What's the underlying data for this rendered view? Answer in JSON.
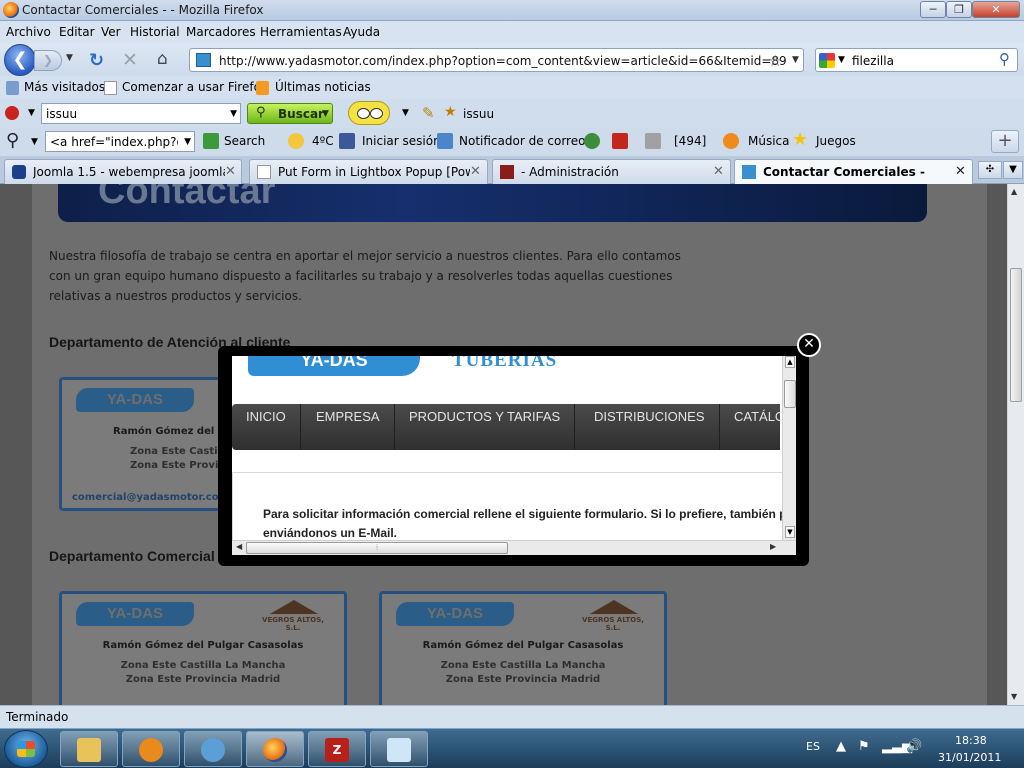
{
  "window": {
    "title": "Contactar Comerciales - - Mozilla Firefox",
    "min": "─",
    "max": "❐",
    "close": "✕"
  },
  "menu": [
    "Archivo",
    "Editar",
    "Ver",
    "Historial",
    "Marcadores",
    "Herramientas",
    "Ayuda"
  ],
  "nav": {
    "url": "http://www.yadasmotor.com/index.php?option=com_content&view=article&id=66&Itemid=89",
    "search_query": "filezilla"
  },
  "bookmarks": [
    "Más visitados",
    "Comenzar a usar Firefox",
    "Últimas noticias"
  ],
  "toolbar1": {
    "search_value": "issuu",
    "buscar_label": "Buscar",
    "issuu_label": "issuu"
  },
  "toolbar2": {
    "combo_value": "<a href=\"index.php?opt",
    "search_label": "Search",
    "weather": "4ºC",
    "facebook": "Iniciar sesión",
    "mail": "Notificador de correo",
    "count": "[494]",
    "music": "Música",
    "games": "Juegos"
  },
  "tabs": [
    {
      "label": "Joomla 1.5 - webempresa joomla -..."
    },
    {
      "label": "Put Form in Lightbox Popup [Pow..."
    },
    {
      "label": "- Administración"
    },
    {
      "label": "Contactar Comerciales -"
    }
  ],
  "page": {
    "hero": "Contactar",
    "intro": "Nuestra filosofía de trabajo se centra en aportar el mejor servicio a nuestros clientes. Para ello contamos con un gran equipo humano dispuesto a facilitarles su trabajo y a resolverles todas aquellas cuestiones relativas a nuestros productos y servicios.",
    "dept1": "Departamento de Atención al cliente",
    "dept2": "Departamento Comercial",
    "card1": {
      "logo": "YA-DAS",
      "name": "Ramón Gómez del Pu",
      "zone1": "Zona Este Castilla",
      "zone2": "Zona Este Provinc",
      "email": "comercial@yadasmotor.com"
    },
    "card2": {
      "logo": "YA-DAS",
      "vegros": "VEGROS ALTOS, S.L.",
      "name": "Ramón Gómez del Pulgar Casasolas",
      "zone1": "Zona Este Castilla La Mancha",
      "zone2": "Zona Este Provincia Madrid"
    },
    "card3": {
      "logo": "YA-DAS",
      "vegros": "VEGROS ALTOS, S.L.",
      "name": "Ramón Gómez del Pulgar Casasolas",
      "zone1": "Zona Este Castilla La Mancha",
      "zone2": "Zona Este Provincia Madrid"
    }
  },
  "lightbox": {
    "logo": "YA-DAS",
    "subtitle": "TUBERIAS",
    "nav": [
      "INICIO",
      "EMPRESA",
      "PRODUCTOS Y TARIFAS",
      "DISTRIBUCIONES",
      "CATÁLO"
    ],
    "form_line1": "Para solicitar información comercial rellene el siguiente formulario. Si lo prefiere, también p",
    "form_line2": "enviándonos un E-Mail."
  },
  "status": "Terminado",
  "taskbar": {
    "lang": "ES",
    "time": "18:38",
    "date": "31/01/2011"
  }
}
